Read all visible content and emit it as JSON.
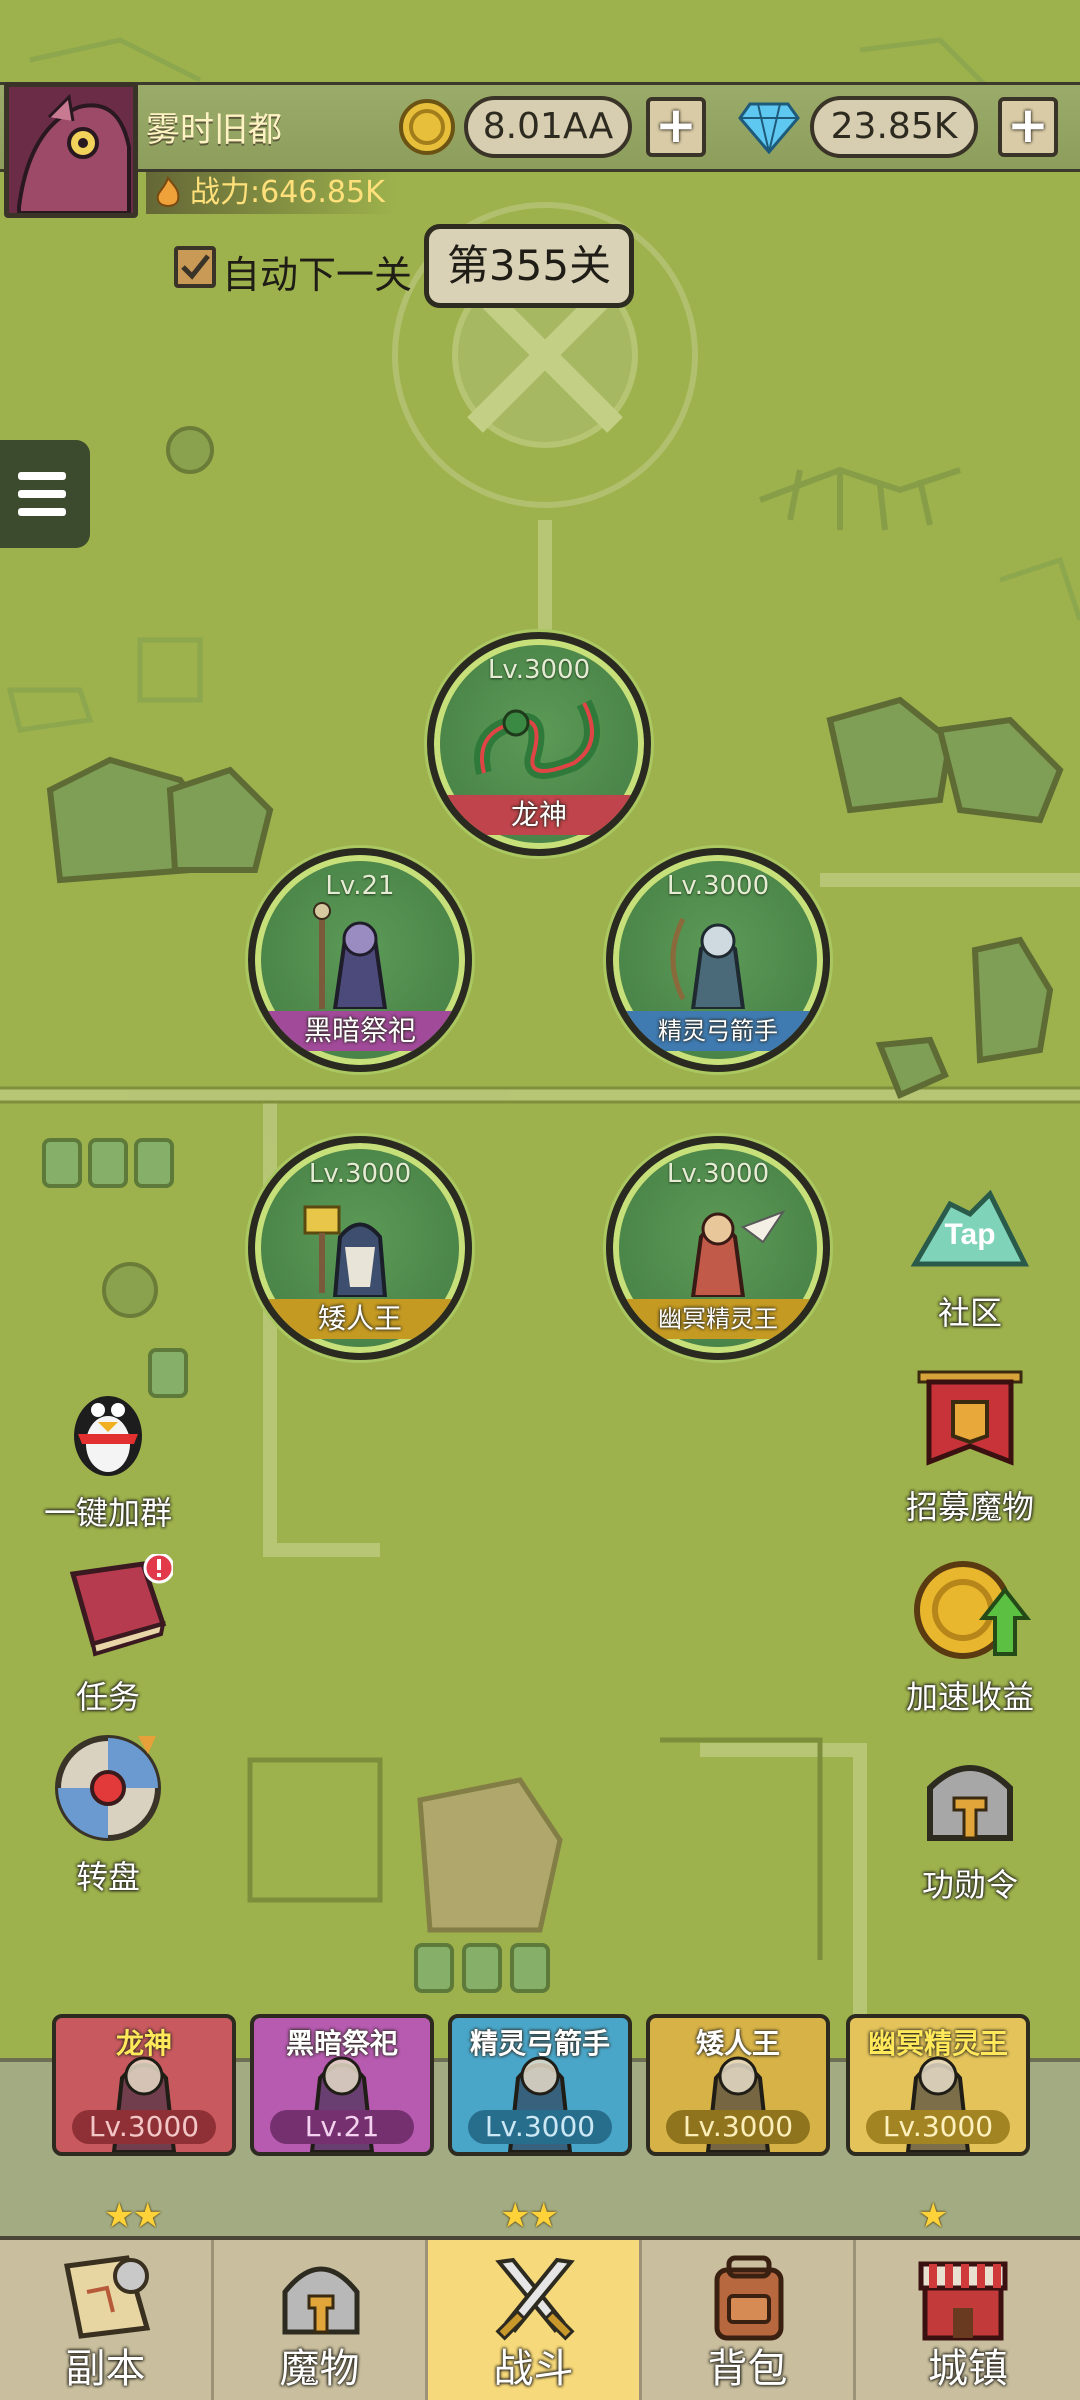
{
  "player": {
    "name": "雾时旧都",
    "power": "战力:646.85K"
  },
  "currency": {
    "gold": "8.01AA",
    "gems": "23.85K",
    "plus": "+"
  },
  "stage": {
    "auto_label": "自动下一关",
    "auto_checked": true,
    "current": "第355关"
  },
  "nodes": [
    {
      "level": "Lv.3000",
      "name": "龙神",
      "color": "#c0444b"
    },
    {
      "level": "Lv.21",
      "name": "黑暗祭祀",
      "color": "#a24a9a"
    },
    {
      "level": "Lv.3000",
      "name": "精灵弓箭手",
      "color": "#3f7bb1"
    },
    {
      "level": "Lv.3000",
      "name": "矮人王",
      "color": "#c49a22"
    },
    {
      "level": "Lv.3000",
      "name": "幽冥精灵王",
      "color": "#c49a22"
    }
  ],
  "side_left": [
    {
      "label": "一键加群",
      "icon": "penguin-icon"
    },
    {
      "label": "任务",
      "icon": "quest-book-icon"
    },
    {
      "label": "转盘",
      "icon": "wheel-icon"
    }
  ],
  "side_right": [
    {
      "label": "社区",
      "icon": "tap-community-icon",
      "icon_text": "Tap"
    },
    {
      "label": "招募魔物",
      "icon": "recruit-banner-icon"
    },
    {
      "label": "加速收益",
      "icon": "speed-coin-icon"
    },
    {
      "label": "功勋令",
      "icon": "helmet-icon"
    }
  ],
  "team": [
    {
      "name": "龙神",
      "level": "Lv.3000",
      "stars": "★★",
      "bg": "#c85a5f",
      "lvbg": "#8e3036",
      "lvcolor": "#f3c6c6",
      "namecolor": "#ffe85a"
    },
    {
      "name": "黑暗祭祀",
      "level": "Lv.21",
      "bg": "#b65bb0",
      "lvbg": "#74306f",
      "lvcolor": "#f3d1ef",
      "namecolor": "#ffffff"
    },
    {
      "name": "精灵弓箭手",
      "level": "Lv.3000",
      "stars": "★★",
      "bg": "#4aa6c9",
      "lvbg": "#276d8c",
      "lvcolor": "#cde8f5",
      "namecolor": "#ffffff"
    },
    {
      "name": "矮人王",
      "level": "Lv.3000",
      "bg": "#d6b247",
      "lvbg": "#8f741d",
      "lvcolor": "#fbeeb8",
      "namecolor": "#ffffff"
    },
    {
      "name": "幽冥精灵王",
      "level": "Lv.3000",
      "stars": "★",
      "bg": "#e3c35a",
      "lvbg": "#a38422",
      "lvcolor": "#fff1bd",
      "namecolor": "#ffe85a"
    }
  ],
  "nav": [
    {
      "label": "副本",
      "icon": "map-scroll-icon",
      "active": false
    },
    {
      "label": "魔物",
      "icon": "monster-helmet-icon",
      "active": false
    },
    {
      "label": "战斗",
      "icon": "crossed-swords-icon",
      "active": true
    },
    {
      "label": "背包",
      "icon": "backpack-icon",
      "active": false
    },
    {
      "label": "城镇",
      "icon": "town-shop-icon",
      "active": false
    }
  ]
}
